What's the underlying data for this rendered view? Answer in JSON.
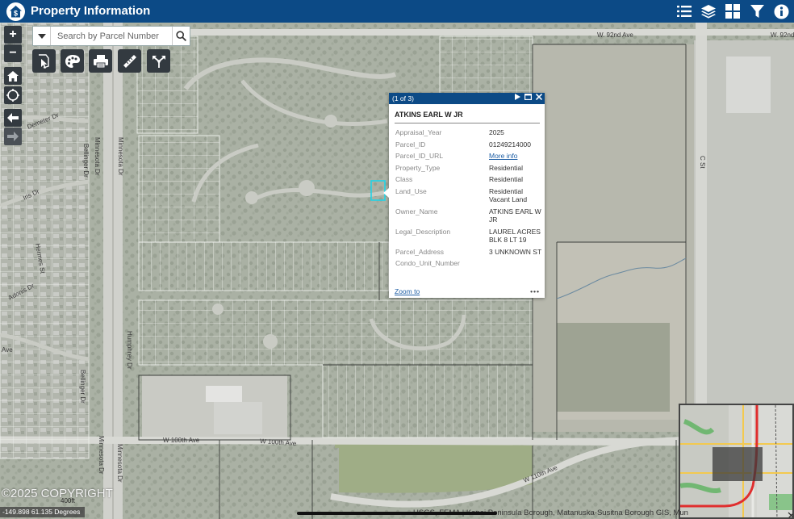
{
  "header": {
    "title": "Property Information",
    "icons": [
      "legend-list-icon",
      "layers-icon",
      "basemap-gallery-icon",
      "filter-icon",
      "info-icon"
    ]
  },
  "search": {
    "placeholder": "Search by Parcel Number",
    "value": ""
  },
  "map_controls": {
    "zoom_in": "+",
    "zoom_out": "−",
    "tools": [
      "select-parcel-icon",
      "palette-icon",
      "print-icon",
      "measure-icon",
      "share-icon"
    ]
  },
  "roads": {
    "w92": "W. 92nd Ave",
    "w92_right": "W. 92nd",
    "w100": "W 100th Ave",
    "w100_b": "W 100th Ave",
    "w110": "W 110th Ave",
    "minnesota_left": "Minnesota Dr",
    "minnesota_right": "Minnesota Dr",
    "minnesota_low_left": "Minnesota Dr",
    "minnesota_low_right": "Minnesota Dr",
    "bellinger": "Bellinger Dr",
    "bellinger_low": "Bellinger Dr",
    "humphrey": "Humphrey Dr",
    "demeter": "Demeter Dr",
    "iris": "Iris Dr",
    "hermes": "Hermes St",
    "adonis": "Adonis Dr",
    "ave": "Ave",
    "c_st": "C St"
  },
  "popup": {
    "counter": "(1 of 3)",
    "title": "ATKINS EARL W JR",
    "attributes": [
      {
        "key": "Appraisal_Year",
        "value": "2025"
      },
      {
        "key": "Parcel_ID",
        "value": "01249214000"
      },
      {
        "key": "Parcel_ID_URL",
        "value": "More info",
        "link": true
      },
      {
        "key": "Property_Type",
        "value": "Residential"
      },
      {
        "key": "Class",
        "value": "Residential"
      },
      {
        "key": "Land_Use",
        "value": "Residential Vacant Land"
      },
      {
        "key": "Owner_Name",
        "value": "ATKINS EARL W JR"
      },
      {
        "key": "Legal_Description",
        "value": "LAUREL ACRES BLK 8 LT 19"
      },
      {
        "key": "Parcel_Address",
        "value": "3 UNKNOWN ST"
      },
      {
        "key": "Condo_Unit_Number",
        "value": ""
      }
    ],
    "zoom_to": "Zoom to",
    "more": "•••"
  },
  "footer": {
    "copyright": "©2025 COPYRIGHT",
    "coordinates": "-149.898 61.135 Degrees",
    "scale_label": "400ft",
    "attribution": "USGS, FEMA | Kenai Peninsula Borough, Matanuska-Susitna Borough GIS, Mun"
  },
  "colors": {
    "header": "#0c4a86",
    "control": "#333a40",
    "parcel_highlight": "#22d3e6",
    "overview_road": "#e02e2e"
  }
}
